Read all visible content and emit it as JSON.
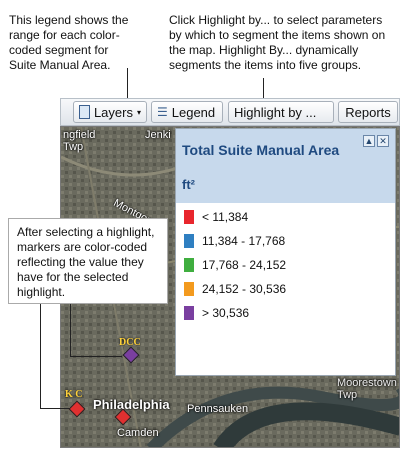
{
  "callouts": {
    "legend_note": "This legend shows the range for each color-coded segment for Suite Manual Area.",
    "highlight_note": "Click Highlight by... to select parameters by which to segment the items shown on the map. Highlight By... dynamically segments the items into five groups.",
    "markers_note": "After selecting a highlight, markers are color-coded reflecting the value they have for the selected highlight."
  },
  "toolbar": {
    "layers_label": "Layers",
    "legend_label": "Legend",
    "highlight_label": "Highlight by ...",
    "reports_label": "Reports"
  },
  "map": {
    "labels": {
      "springfield": "ngfield\nTwp",
      "jenkintown": "Jenki",
      "montgomery": "Montgome",
      "philadelphia": "Philadelphia",
      "pennsauken": "Pennsauken",
      "camden": "Camden",
      "moorestown": "Moorestown\nTwp"
    },
    "markers": [
      {
        "label": "DCC",
        "color": "#7a3fa0"
      },
      {
        "label": "K C",
        "color": "#e03030"
      },
      {
        "label": "",
        "color": "#e03030"
      }
    ]
  },
  "legend": {
    "title": "Total Suite Manual Area",
    "unit": "ft²",
    "items": [
      {
        "label": "< 11,384",
        "color": "#e8262d"
      },
      {
        "label": "11,384 - 17,768",
        "color": "#2f7fc1"
      },
      {
        "label": "17,768 - 24,152",
        "color": "#3fae3f"
      },
      {
        "label": "24,152 - 30,536",
        "color": "#f39a1e"
      },
      {
        "label": "> 30,536",
        "color": "#7a3fa0"
      }
    ]
  }
}
